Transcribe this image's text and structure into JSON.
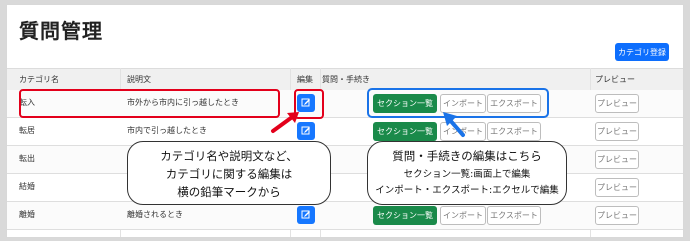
{
  "page": {
    "title": "質問管理"
  },
  "toolbar": {
    "add_category_label": "カテゴリ登録"
  },
  "table": {
    "headers": {
      "category": "カテゴリ名",
      "description": "説明文",
      "edit": "編集",
      "questions": "質問・手続き",
      "preview": "プレビュー"
    },
    "rows": [
      {
        "name": "転入",
        "description": "市外から市内に引っ越したとき"
      },
      {
        "name": "転居",
        "description": "市内で引っ越したとき"
      },
      {
        "name": "転出",
        "description": ""
      },
      {
        "name": "結婚",
        "description": ""
      },
      {
        "name": "離婚",
        "description": "離婚されるとき"
      }
    ],
    "buttons": {
      "section_list": "セクション一覧",
      "import": "インポート",
      "export": "エクスポート",
      "preview": "プレビュー"
    }
  },
  "callouts": {
    "left": {
      "line1": "カテゴリ名や説明文など、",
      "line2": "カテゴリに関する編集は",
      "line3": "横の鉛筆マークから"
    },
    "right": {
      "line1": "質問・手続きの編集はこちら",
      "line2": "セクション一覧:画面上で編集",
      "line3": "インポート・エクスポート:エクセルで編集"
    }
  },
  "colors": {
    "primary": "#0d6efd",
    "success": "#1a8a4a",
    "highlight_red": "#e3001b",
    "highlight_blue": "#1a73e8"
  }
}
